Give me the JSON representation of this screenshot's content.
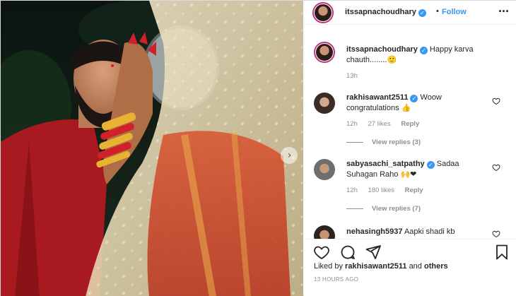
{
  "post": {
    "author": "itssapnachoudhary",
    "follow_label": "Follow",
    "separator": "•",
    "more_label": "···",
    "caption": {
      "user": "itssapnachoudhary",
      "text": "Happy karva chauth........🙂",
      "time": "13h"
    },
    "liked_by_prefix": "Liked by",
    "liked_by_user": "rakhisawant2511",
    "liked_by_and": "and",
    "liked_by_others": "others",
    "time_ago": "13 HOURS AGO",
    "next_arrow": "›"
  },
  "comments": [
    {
      "user": "rakhisawant2511",
      "text": "Woow congratulations 👍",
      "time": "12h",
      "likes": "27 likes",
      "reply_label": "Reply",
      "view_replies": "View replies (3)",
      "avatar_color": "#7d6a5e"
    },
    {
      "user": "sabyasachi_satpathy",
      "text": "Sadaa Suhagan Raho 🙌❤",
      "time": "12h",
      "likes": "180 likes",
      "reply_label": "Reply",
      "view_replies": "View replies (7)",
      "avatar_color": "#b8a07e"
    },
    {
      "user": "nehasingh5937",
      "text": "Aapki shadi kb",
      "avatar_color": "#6f6f6f"
    }
  ],
  "colors": {
    "link": "#3897f0",
    "verified": "#3897f0",
    "story_ring": "#c13584",
    "muted": "#8e8e8e"
  },
  "icons": {
    "verified": "verified-badge-icon",
    "heart": "heart-icon",
    "comment": "comment-icon",
    "share": "share-icon",
    "bookmark": "bookmark-icon",
    "more": "more-options-icon",
    "next": "chevron-right-icon"
  }
}
